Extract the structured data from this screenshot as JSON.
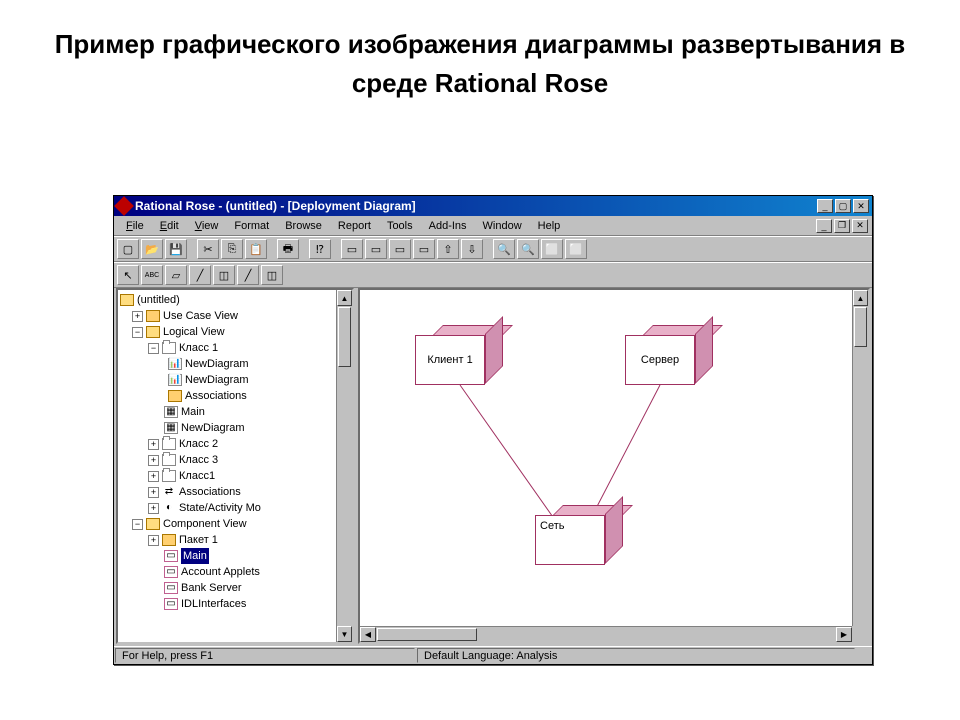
{
  "slide": {
    "title": "Пример графического изображения диаграммы развертывания в среде Rational Rose"
  },
  "window": {
    "title": "Rational Rose - (untitled) - [Deployment Diagram]"
  },
  "menu": {
    "file": "File",
    "edit": "Edit",
    "view": "View",
    "format": "Format",
    "browse": "Browse",
    "report": "Report",
    "tools": "Tools",
    "addins": "Add-Ins",
    "window": "Window",
    "help": "Help"
  },
  "toolbox": {
    "pointer": "↖",
    "abc": "ABC"
  },
  "tree": {
    "root": "(untitled)",
    "usecase": "Use Case View",
    "logical": "Logical View",
    "class1": "Класс 1",
    "newdiag1": "NewDiagram",
    "newdiag2": "NewDiagram",
    "assoc1": "Associations",
    "main": "Main",
    "newdiag3": "NewDiagram",
    "class2": "Класс 2",
    "class3": "Класс 3",
    "class1b": "Класс1",
    "assoc2": "Associations",
    "stateact": "State/Activity Mo",
    "component": "Component View",
    "paket1": "Пакет 1",
    "main2": "Main",
    "account": "Account Applets",
    "bank": "Bank Server",
    "idl": "IDLInterfaces"
  },
  "diagram": {
    "client": "Клиент 1",
    "server": "Сервер",
    "network": "Сеть"
  },
  "status": {
    "help": "For Help, press F1",
    "lang": "Default Language: Analysis"
  }
}
